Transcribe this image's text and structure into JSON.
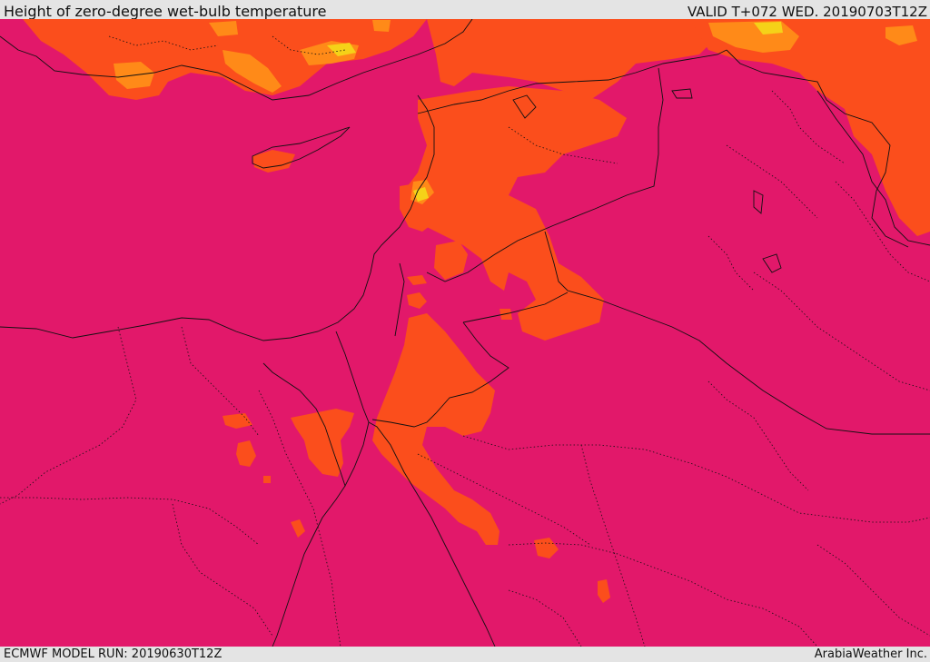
{
  "header": {
    "title": "Height of zero-degree wet-bulb temperature",
    "valid": "VALID T+072 WED. 20190703T12Z"
  },
  "footer": {
    "model_run": "ECMWF MODEL RUN: 20190630T12Z",
    "credit": "ArabiaWeather Inc."
  },
  "colors": {
    "base_fill": "#e2186a",
    "mid_fill": "#fb4e1c",
    "high_fill": "#ff8a18",
    "peak_fill": "#f5d218",
    "border": "#111111"
  }
}
